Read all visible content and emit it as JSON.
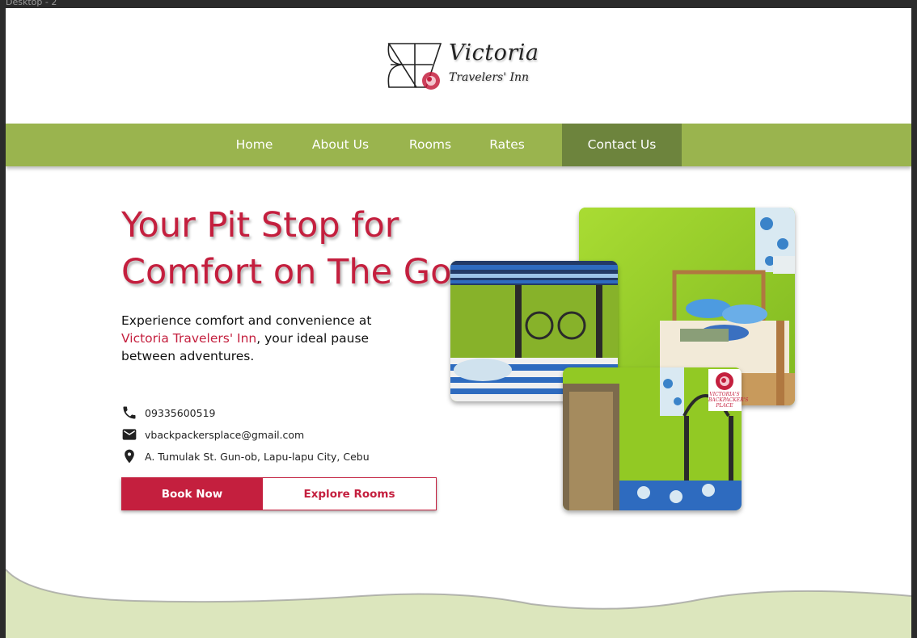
{
  "frame": {
    "label": "Desktop - 2"
  },
  "brand": {
    "name": "Victoria",
    "subtitle": "Travelers' Inn"
  },
  "nav": {
    "items": [
      {
        "label": "Home"
      },
      {
        "label": "About Us"
      },
      {
        "label": "Rooms"
      },
      {
        "label": "Rates"
      },
      {
        "label": "Contact Us",
        "active": true
      }
    ]
  },
  "hero": {
    "title_line1": "Your Pit Stop for",
    "title_line2": "Comfort on The Go",
    "desc_pre": "Experience comfort and convenience at ",
    "desc_accent": "Victoria Travelers' Inn",
    "desc_post": ", your ideal pause between adventures."
  },
  "contact": {
    "phone": "09335600519",
    "email": "vbackpackersplace@gmail.com",
    "address": "A. Tumulak St. Gun-ob, Lapu-lapu City, Cebu"
  },
  "buttons": {
    "book": "Book Now",
    "explore": "Explore Rooms"
  },
  "photos": {
    "badge_text": "VICTORIA'S BACKPACKER'S PLACE"
  },
  "colors": {
    "accent": "#c41f3e",
    "nav": "#9ab44e",
    "nav_active": "#6d843d",
    "footer_wave": "#dce6bd"
  },
  "icons": {
    "phone": "phone-icon",
    "email": "mail-icon",
    "address": "location-pin-icon"
  }
}
